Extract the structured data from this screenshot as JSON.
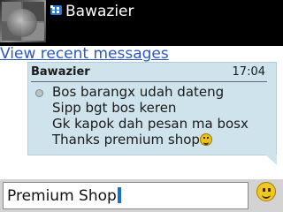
{
  "header": {
    "contact_name": "Bawazier",
    "icon": "bbm-chat-icon"
  },
  "history_link": "View recent messages",
  "message": {
    "sender": "Bawazier",
    "time": "17:04",
    "lines": [
      "Bos barangx udah dateng",
      "Sipp bgt bos keren",
      "Gk kapok dah pesan ma bosx",
      "Thanks premium shop"
    ],
    "status_icon": "message-status-dot-icon",
    "trailing_emoticon": "smiley-icon"
  },
  "compose": {
    "value": "Premium Shop",
    "emoticon_icon": "smiley-icon"
  },
  "colors": {
    "header_bg": "#000000",
    "link": "#2a56c8",
    "bubble_bg": "#cfe3ec",
    "compose_bar": "#d3d3d3",
    "cursor": "#1570d6"
  }
}
